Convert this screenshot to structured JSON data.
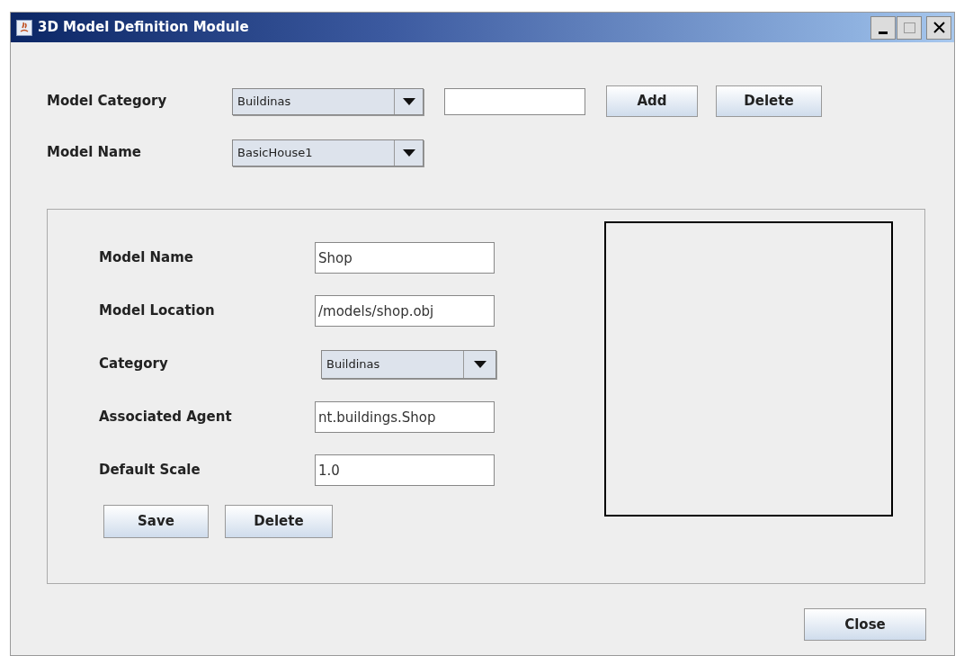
{
  "window": {
    "title": "3D Model Definition Module"
  },
  "top": {
    "category_label": "Model Category",
    "category_value": "Buildinas",
    "add_button": "Add",
    "delete_button": "Delete",
    "name_label": "Model Name",
    "name_value": "BasicHouse1"
  },
  "details": {
    "fields": [
      {
        "kind": "text",
        "label": "Model Name",
        "value": "Shop"
      },
      {
        "kind": "text",
        "label": "Model Location",
        "value": "/models/shop.obj"
      },
      {
        "kind": "combo",
        "label": "Category",
        "value": "Buildinas"
      },
      {
        "kind": "text",
        "label": "Associated Agent",
        "value": "nt.buildings.Shop"
      },
      {
        "kind": "text",
        "label": "Default Scale",
        "value": "1.0"
      }
    ],
    "buttons": [
      "Save",
      "Delete"
    ]
  },
  "close_button": "Close"
}
